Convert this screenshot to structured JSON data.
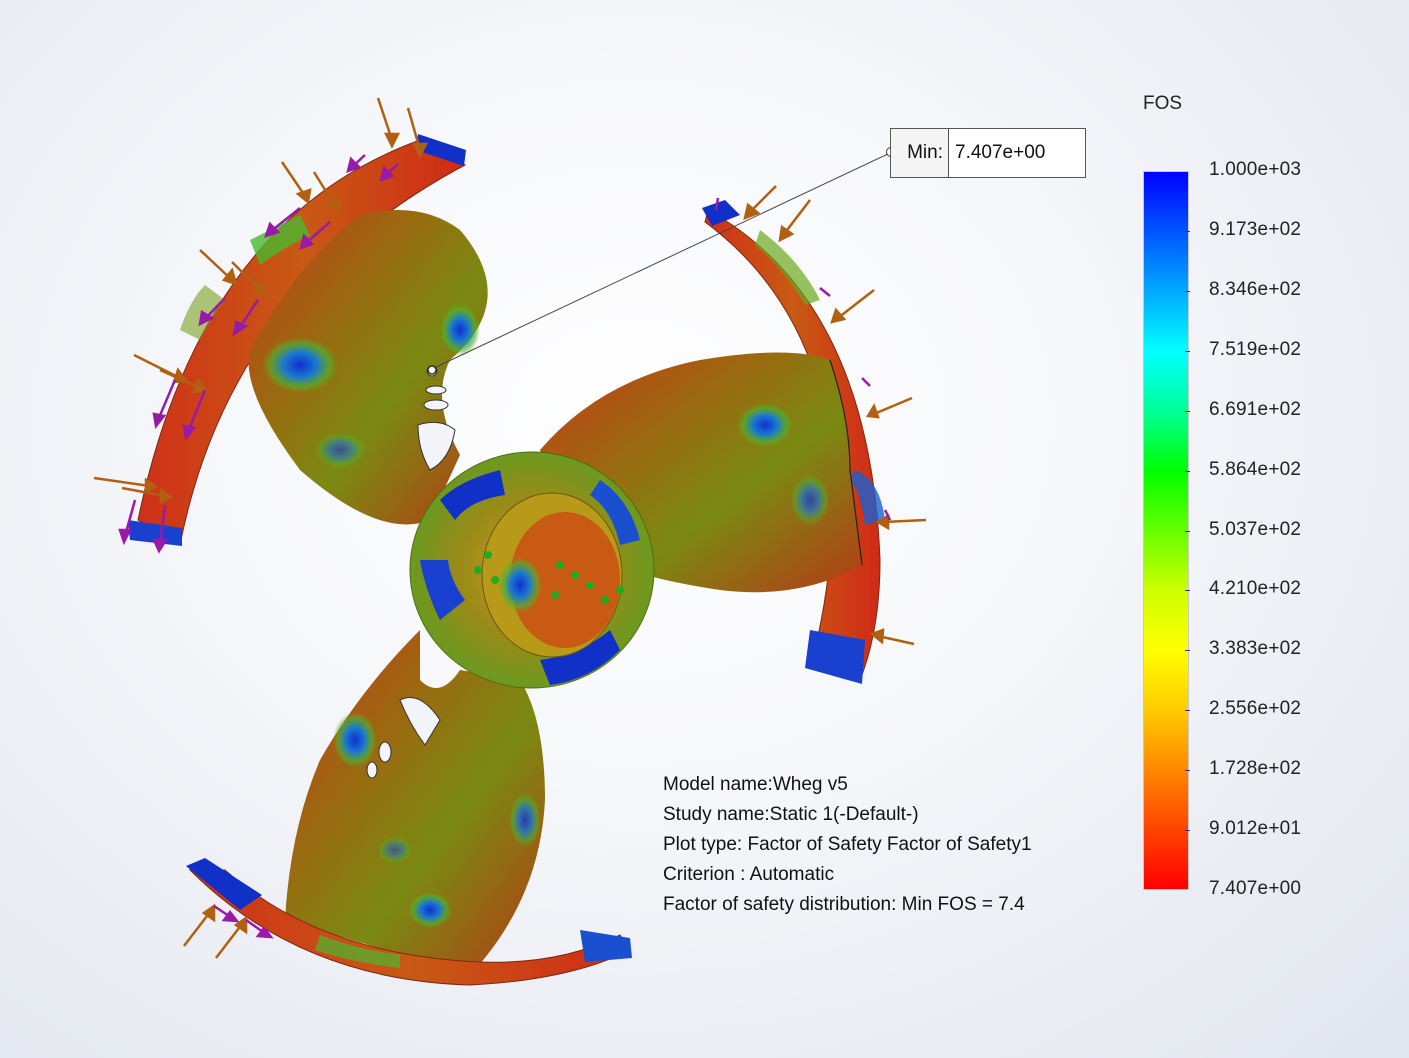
{
  "legend": {
    "title": "FOS",
    "ticks": [
      "1.000e+03",
      "9.173e+02",
      "8.346e+02",
      "7.519e+02",
      "6.691e+02",
      "5.864e+02",
      "5.037e+02",
      "4.210e+02",
      "3.383e+02",
      "2.556e+02",
      "1.728e+02",
      "9.012e+01",
      "7.407e+00"
    ],
    "gradient_colors": [
      "#0000ff",
      "#0055ff",
      "#00aaff",
      "#00ffff",
      "#00ff99",
      "#00ff00",
      "#66ff00",
      "#ccff00",
      "#ffff00",
      "#ffcc00",
      "#ff8800",
      "#ff4400",
      "#ff0000"
    ]
  },
  "callout": {
    "label": "Min:",
    "value": "7.407e+00"
  },
  "info": {
    "model_name": "Model name:Wheg v5",
    "study_name": "Study name:Static 1(-Default-)",
    "plot_type": "Plot type: Factor of Safety Factor of Safety1",
    "criterion": "Criterion : Automatic",
    "distribution": "Factor of safety distribution: Min FOS = 7.4"
  },
  "colors": {
    "load_arrow": "#b06010",
    "fixture_arrow": "#9a1aa8",
    "fixture_marker": "#22aa22"
  }
}
